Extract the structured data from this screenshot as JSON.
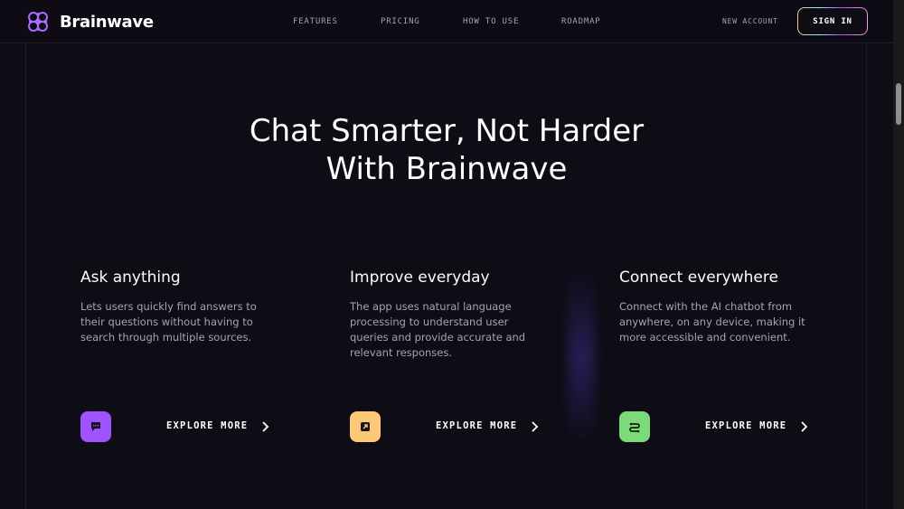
{
  "brand": {
    "name": "Brainwave"
  },
  "nav": {
    "links": [
      "FEATURES",
      "PRICING",
      "HOW TO USE",
      "ROADMAP"
    ],
    "new_account": "NEW ACCOUNT",
    "sign_in": "SIGN IN"
  },
  "hero": {
    "title_line1": "Chat Smarter, Not Harder",
    "title_line2": "With Brainwave"
  },
  "features": [
    {
      "title": "Ask anything",
      "description": "Lets users quickly find answers to their questions without having to search through multiple sources.",
      "cta": "EXPLORE MORE",
      "icon": "chat-bubble-icon",
      "icon_color": "#9f53ff"
    },
    {
      "title": "Improve everyday",
      "description": "The app uses natural language processing to understand user queries and provide accurate and relevant responses.",
      "cta": "EXPLORE MORE",
      "icon": "expand-icon",
      "icon_color": "#ffc876"
    },
    {
      "title": "Connect everywhere",
      "description": "Connect with the AI chatbot from anywhere, on any device, making it more accessible and convenient.",
      "cta": "EXPLORE MORE",
      "icon": "connect-icon",
      "icon_color": "#7adb78"
    }
  ],
  "colors": {
    "background": "#0e0c15",
    "text_primary": "#fefefe",
    "text_muted": "#a6a3b5",
    "accent_purple": "#9f53ff"
  }
}
